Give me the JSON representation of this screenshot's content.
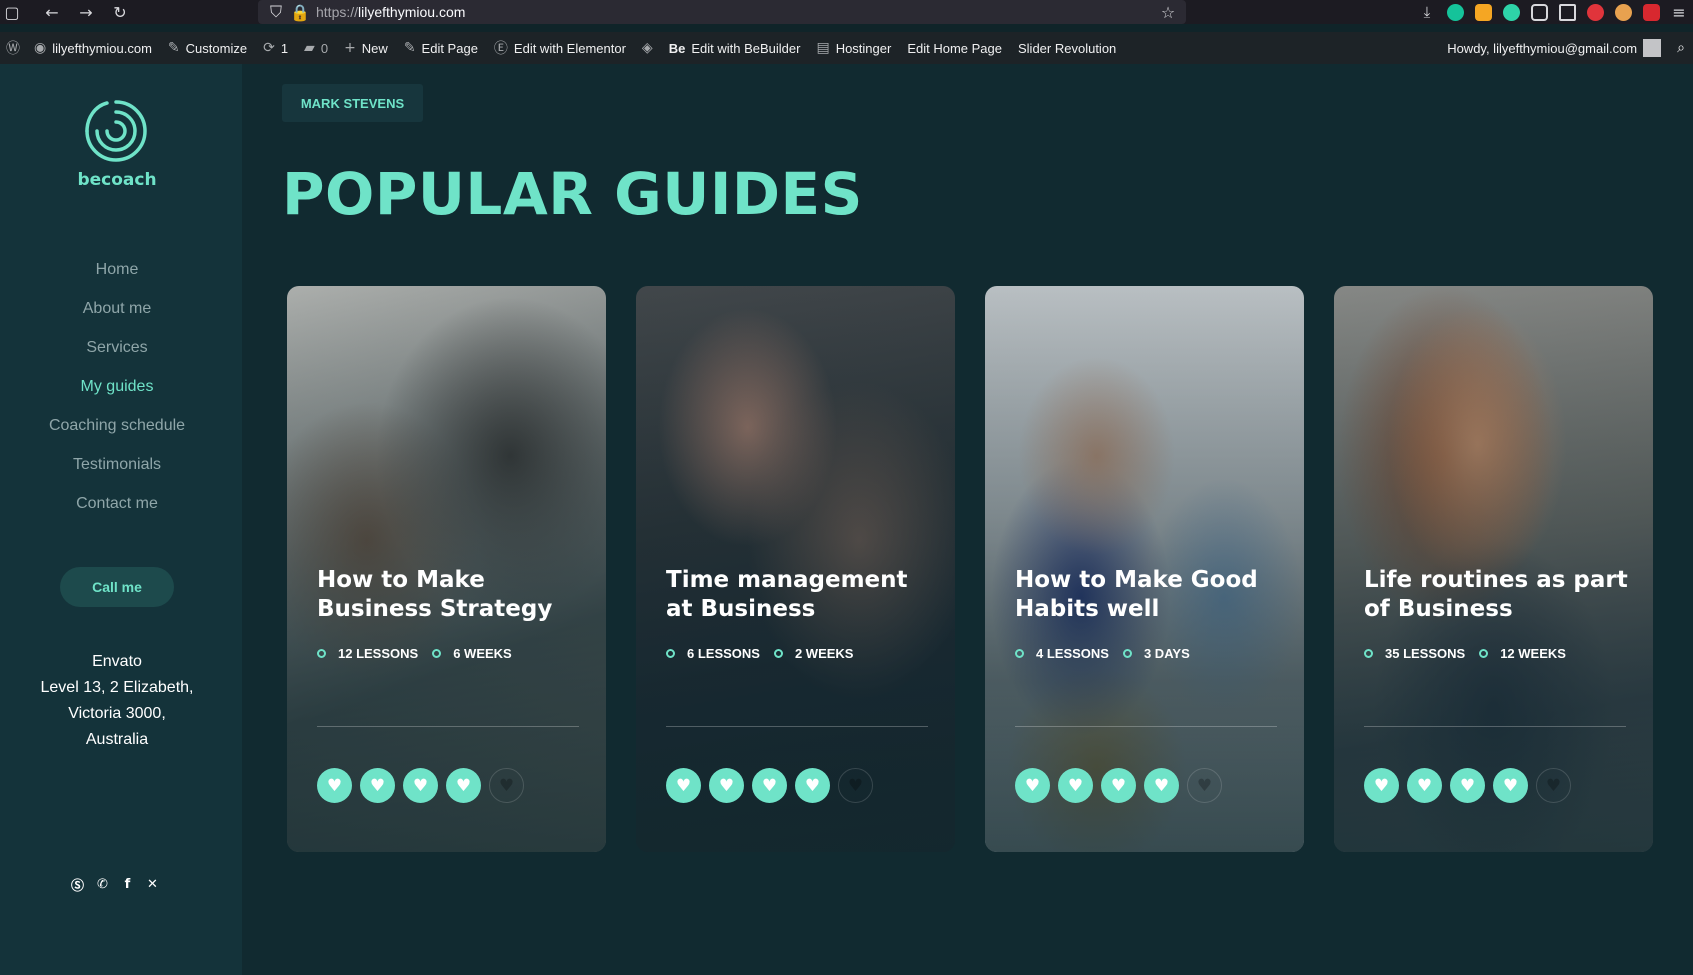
{
  "browser": {
    "url_protocol": "https://",
    "url_host": "lilyefthymiou.com"
  },
  "admin_bar": {
    "site": "lilyefthymiou.com",
    "customize": "Customize",
    "updates_count": "1",
    "comments_count": "0",
    "new": "New",
    "edit_page": "Edit Page",
    "edit_elementor": "Edit with Elementor",
    "bebuilder_prefix": "Be",
    "edit_bebuilder": "Edit with BeBuilder",
    "hostinger": "Hostinger",
    "edit_home": "Edit Home Page",
    "slider_revolution": "Slider Revolution",
    "howdy": "Howdy, lilyefthymiou@gmail.com"
  },
  "sidebar": {
    "brand": "becoach",
    "menu": [
      {
        "label": "Home",
        "active": false
      },
      {
        "label": "About me",
        "active": false
      },
      {
        "label": "Services",
        "active": false
      },
      {
        "label": "My guides",
        "active": true
      },
      {
        "label": "Coaching schedule",
        "active": false
      },
      {
        "label": "Testimonials",
        "active": false
      },
      {
        "label": "Contact me",
        "active": false
      }
    ],
    "call_button": "Call me",
    "address": [
      "Envato",
      "Level 13, 2 Elizabeth,",
      "Victoria 3000,",
      "Australia"
    ],
    "socials": [
      "skype-icon",
      "whatsapp-icon",
      "facebook-icon",
      "x-icon"
    ]
  },
  "main": {
    "author_tag": "MARK STEVENS",
    "headline": "POPULAR GUIDES"
  },
  "cards": [
    {
      "title": "How to Make Business Strategy",
      "lessons": "12 LESSONS",
      "duration": "6 WEEKS",
      "rating": 4,
      "max_rating": 5
    },
    {
      "title": "Time management at Business",
      "lessons": "6 LESSONS",
      "duration": "2 WEEKS",
      "rating": 4,
      "max_rating": 5
    },
    {
      "title": "How to Make Good Habits well",
      "lessons": "4 LESSONS",
      "duration": "3 DAYS",
      "rating": 4,
      "max_rating": 5
    },
    {
      "title": "Life routines as part of Business",
      "lessons": "35 LESSONS",
      "duration": "12 WEEKS",
      "rating": 4,
      "max_rating": 5
    }
  ],
  "colors": {
    "accent": "#6fe3c8",
    "page_bg": "#112a30",
    "sidebar_bg": "#14333a"
  }
}
